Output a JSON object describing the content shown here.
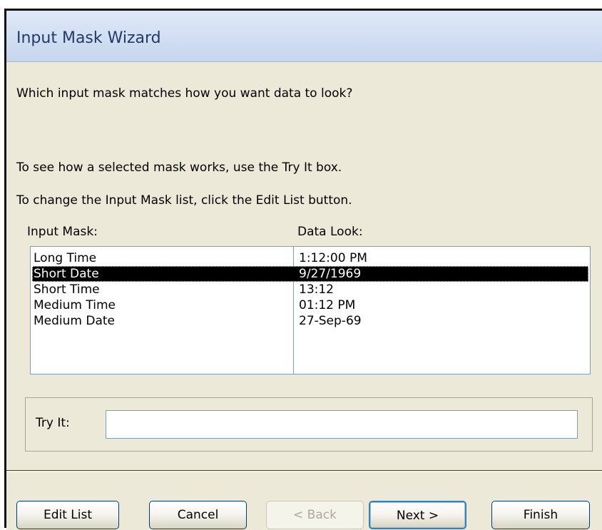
{
  "window": {
    "title": "Input Mask Wizard"
  },
  "content": {
    "question": "Which input mask matches how you want data to look?",
    "instruction_tryit": "To see how a selected mask works, use the Try It box.",
    "instruction_edit": "To change the Input Mask list, click the Edit List button."
  },
  "list": {
    "header_mask": "Input Mask:",
    "header_look": "Data Look:",
    "selected_index": 1,
    "rows": [
      {
        "mask": "Long Time",
        "look": "1:12:00 PM"
      },
      {
        "mask": "Short Date",
        "look": "9/27/1969"
      },
      {
        "mask": "Short Time",
        "look": "13:12"
      },
      {
        "mask": "Medium Time",
        "look": "01:12 PM"
      },
      {
        "mask": "Medium Date",
        "look": "27-Sep-69"
      }
    ]
  },
  "tryit": {
    "label": "Try It:",
    "value": ""
  },
  "buttons": {
    "edit_list": "Edit List",
    "cancel": "Cancel",
    "back": "< Back",
    "next": "Next >",
    "finish": "Finish"
  },
  "colors": {
    "title_text": "#233a67",
    "dialog_background": "#ece9d8",
    "selection_background": "#000000",
    "selection_text": "#ffffff",
    "border": "#7f9db9"
  }
}
